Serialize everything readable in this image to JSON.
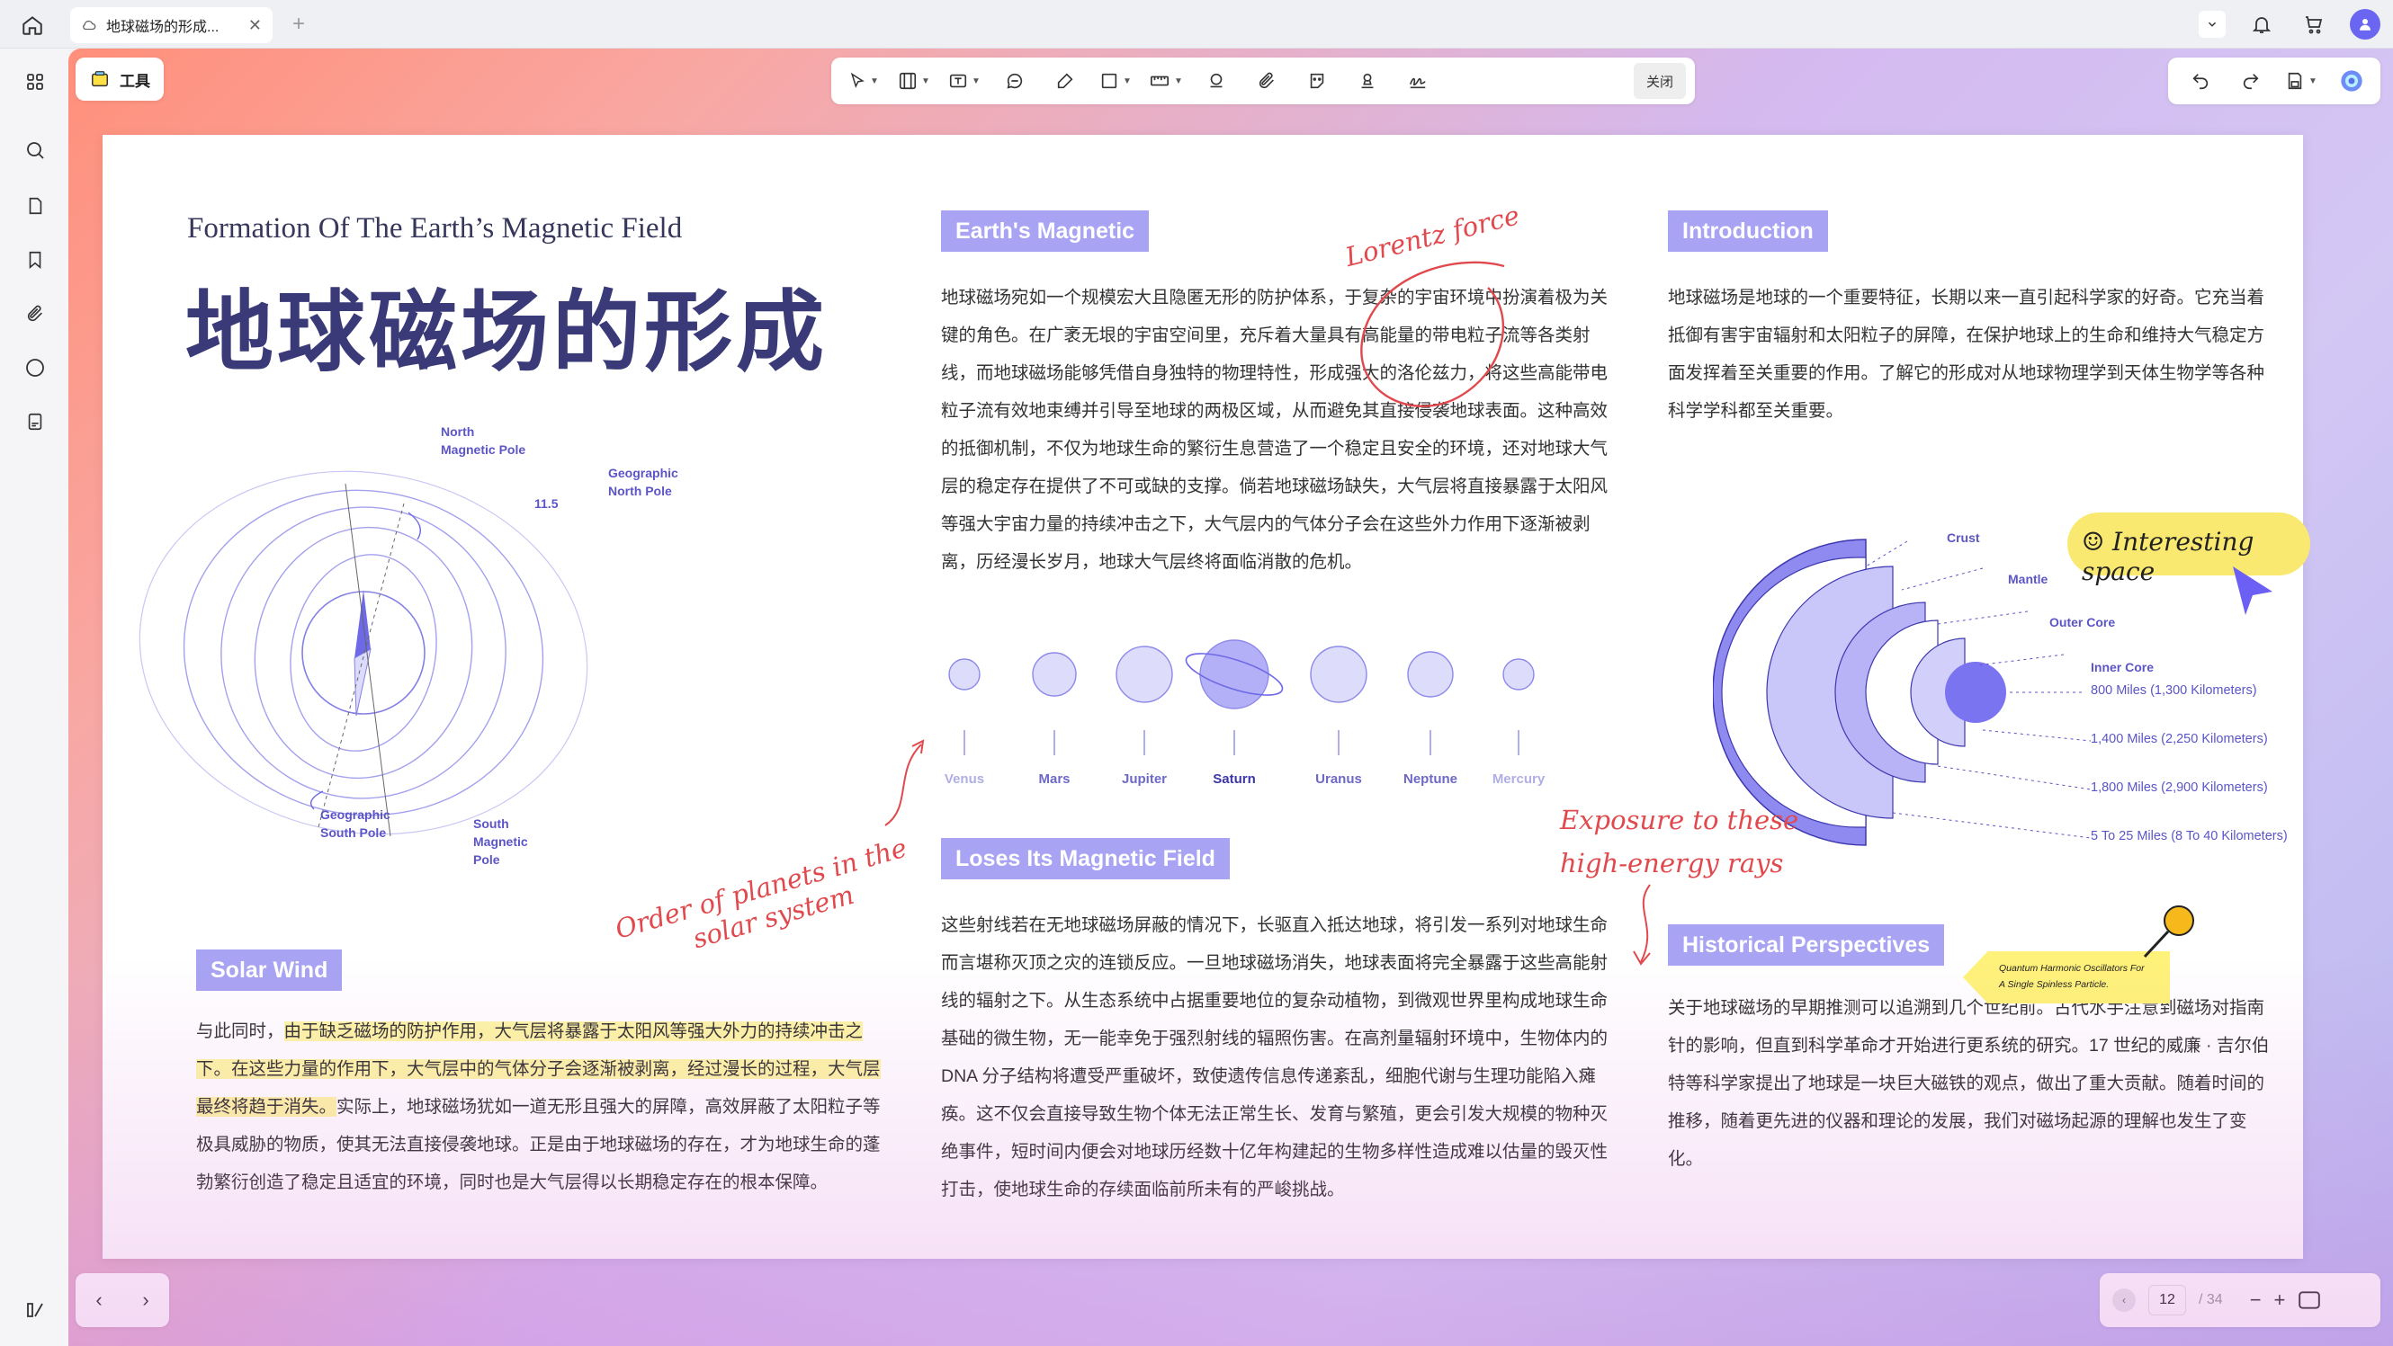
{
  "tab": {
    "title": "地球磁场的形成..."
  },
  "toolbar": {
    "tools_label": "工具",
    "close_label": "关闭"
  },
  "page": {
    "en_title": "Formation Of The Earth’s Magnetic Field",
    "cn_title": "地球磁场的形成",
    "diagram_labels": {
      "north_magnetic": [
        "North",
        "Magnetic Pole"
      ],
      "geo_north": [
        "Geographic",
        "North Pole"
      ],
      "angle": "11.5",
      "geo_south": [
        "Geographic",
        "South Pole"
      ],
      "south_magnetic": [
        "South",
        "Magnetic",
        "Pole"
      ]
    },
    "solar_wind": {
      "tag": "Solar Wind",
      "lines": [
        {
          "pre": "与此同时，",
          "hl": "由于缺乏磁场的防护作用，大气层将暴露于太阳风等强大外力的持续冲击之",
          "post": ""
        },
        {
          "pre": "",
          "hl": "下。在这些力量的作用下，大气层中的气体分子会逐渐被剥离，经过漫长的过程，大气层",
          "post": ""
        },
        {
          "pre": "",
          "hl": "最终将趋于消失。",
          "post": "实际上，地球磁场犹如一道无形且强大的屏障，高效屏蔽了太阳粒子等"
        },
        {
          "pre": "极具威胁的物质，使其无法直接侵袭地球。正是由于地球磁场的存在，才为地球生命的蓬",
          "hl": "",
          "post": ""
        },
        {
          "pre": "勃繁衍创造了稳定且适宜的环境，同时也是大气层得以长期稳定存在的根本保障。",
          "hl": "",
          "post": ""
        }
      ]
    },
    "earths_magnetic": {
      "tag": "Earth's Magnetic",
      "lines": [
        "地球磁场宛如一个规模宏大且隐匿无形的防护体系，于复杂的宇宙环境中扮演着极为关",
        "键的角色。在广袤无垠的宇宙空间里，充斥着大量具有高能量的带电粒子流等各类射",
        "线，而地球磁场能够凭借自身独特的物理特性，形成强大的洛伦兹力，将这些高能带电",
        "粒子流有效地束缚并引导至地球的两极区域，从而避免其直接侵袭地球表面。这种高效",
        "的抵御机制，不仅为地球生命的繁衍生息营造了一个稳定且安全的环境，还对地球大气",
        "层的稳定存在提供了不可或缺的支撑。倘若地球磁场缺失，大气层将直接暴露于太阳风",
        "等强大宇宙力量的持续冲击之下，大气层内的气体分子会在这些外力作用下逐渐被剥",
        "离，历经漫长岁月，地球大气层终将面临消散的危机。"
      ]
    },
    "planets": [
      "Venus",
      "Mars",
      "Jupiter",
      "Saturn",
      "Uranus",
      "Neptune",
      "Mercury"
    ],
    "loses_field": {
      "tag": "Loses Its Magnetic Field",
      "lines": [
        "这些射线若在无地球磁场屏蔽的情况下，长驱直入抵达地球，将引发一系列对地球生命",
        "而言堪称灭顶之灾的连锁反应。一旦地球磁场消失，地球表面将完全暴露于这些高能射",
        "线的辐射之下。从生态系统中占据重要地位的复杂动植物，到微观世界里构成地球生命",
        "基础的微生物，无一能幸免于强烈射线的辐照伤害。在高剂量辐射环境中，生物体内的",
        "DNA 分子结构将遭受严重破坏，致使遗传信息传递紊乱，细胞代谢与生理功能陷入瘫",
        "痪。这不仅会直接导致生物个体无法正常生长、发育与繁殖，更会引发大规模的物种灭",
        "绝事件，短时间内便会对地球历经数十亿年构建起的生物多样性造成难以估量的毁灭性",
        "打击，使地球生命的存续面临前所未有的严峻挑战。"
      ]
    },
    "introduction": {
      "tag": "Introduction",
      "lines": [
        "地球磁场是地球的一个重要特征，长期以来一直引起科学家的好奇。它充当着",
        "抵御有害宇宙辐射和太阳粒子的屏障，在保护地球上的生命和维持大气稳定方",
        "面发挥着至关重要的作用。了解它的形成对从地球物理学到天体生物学等各种",
        "科学学科都至关重要。"
      ]
    },
    "earth_layers": {
      "labels": [
        "Crust",
        "Mantle",
        "Outer Core",
        "Inner Core"
      ],
      "distances": [
        "800 Miles (1,300 Kilometers)",
        "1,400 Miles (2,250 Kilometers)",
        "1,800 Miles (2,900 Kilometers)",
        "5 To 25 Miles (8 To 40 Kilometers)"
      ]
    },
    "historical": {
      "tag": "Historical Perspectives",
      "lines": [
        "关于地球磁场的早期推测可以追溯到几个世纪前。古代水手注意到磁场对指南",
        "针的影响，但直到科学革命才开始进行更系统的研究。17 世纪的威廉 · 吉尔伯",
        "特等科学家提出了地球是一块巨大磁铁的观点，做出了重大贡献。随着时间的",
        "推移，随着更先进的仪器和理论的发展，我们对磁场起源的理解也发生了变",
        "化。"
      ]
    },
    "annotations": {
      "lorentz": "Lorentz force",
      "order": [
        "Order of planets in the",
        "solar system"
      ],
      "exposure": [
        "Exposure to these",
        "high-energy rays"
      ],
      "interesting": "Interesting space",
      "sticky": [
        "Quantum Harmonic Oscillators For",
        "A Single Spinless Particle."
      ]
    }
  },
  "pager": {
    "current": "12",
    "total": "/ 34"
  },
  "colors": {
    "accent": "#a8a3f2",
    "title": "#3a3a78",
    "annotation": "#e0494d",
    "highlight": "#fdf6a6"
  }
}
